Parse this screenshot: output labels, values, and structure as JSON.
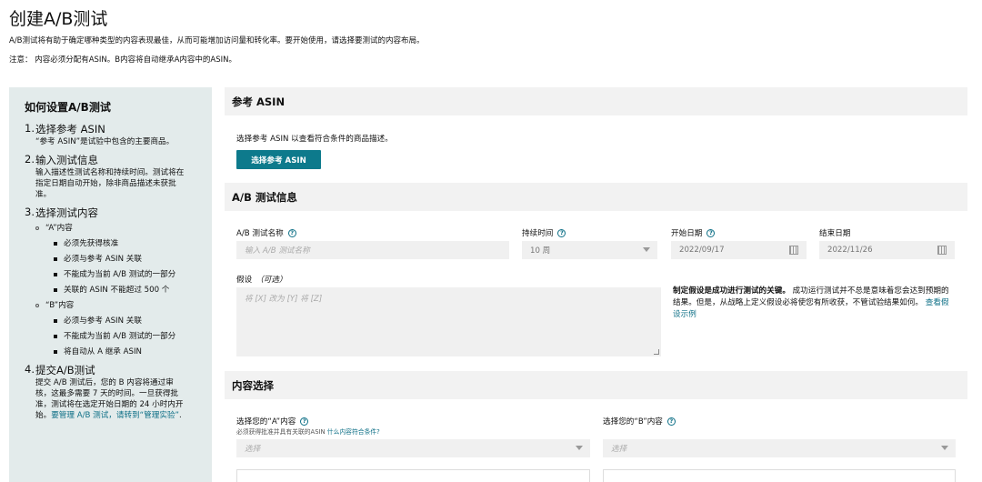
{
  "page": {
    "title": "创建A/B测试",
    "intro": "A/B测试将有助于确定哪种类型的内容表现最佳，从而可能增加访问量和转化率。要开始使用，请选择要测试的内容布局。",
    "note": "注意：  内容必须分配有ASIN。B内容将自动继承A内容中的ASIN。"
  },
  "sidebar": {
    "title": "如何设置A/B测试",
    "step1": {
      "num": "1.",
      "title": "选择参考 ASIN",
      "body": "“参考 ASIN”是试验中包含的主要商品。"
    },
    "step2": {
      "num": "2.",
      "title": "输入测试信息",
      "body": "输入描述性测试名称和持续时间。测试将在指定日期自动开始，除非商品描述未获批准。"
    },
    "step3": {
      "num": "3.",
      "title": "选择测试内容",
      "a_label": "“A”内容",
      "a_items": [
        "必须先获得核准",
        "必须与参考 ASIN 关联",
        "不能成为当前 A/B 测试的一部分",
        "关联的 ASIN 不能超过 500 个"
      ],
      "b_label": "“B”内容",
      "b_items": [
        "必须与参考 ASIN 关联",
        "不能成为当前 A/B 测试的一部分",
        "将自动从 A 继承 ASIN"
      ]
    },
    "step4": {
      "num": "4.",
      "title": "提交A/B测试",
      "body": "提交 A/B 测试后，您的 B 内容将通过审核，这最多需要 7 天的时间。一旦获得批准，测试将在选定开始日期的 24 小时内开始。",
      "link": "要管理 A/B 测试，请转到“管理实验”",
      "tail": "."
    }
  },
  "ref_asin": {
    "header": "参考 ASIN",
    "desc": "选择参考 ASIN 以查看符合条件的商品描述。",
    "button": "选择参考 ASIN"
  },
  "test_info": {
    "header": "A/B 测试信息",
    "name_label": "A/B 测试名称",
    "name_placeholder": "输入 A/B 测试名称",
    "duration_label": "持续时间",
    "duration_value": "10 周",
    "start_label": "开始日期",
    "start_value": "2022/09/17",
    "end_label": "结束日期",
    "end_value": "2022/11/26",
    "hypo_label": "假设",
    "hypo_optional": "（可选）",
    "hypo_placeholder": "将 [X] 改为 [Y] 将 [Z]",
    "hint_bold": "制定假设是成功进行测试的关键。",
    "hint_text": "成功运行测试并不总是意味着您会达到预期的结果。但是，从战略上定义假设必将使您有所收获，不管试验结果如何。",
    "hint_link": "查看假设示例"
  },
  "content_select": {
    "header": "内容选择",
    "a_label": "选择您的“A”内容",
    "a_sub": "必须获得批准并具有关联的ASIN",
    "a_sub_link": "什么内容符合条件?",
    "a_placeholder": "选择",
    "b_label": "选择您的“B”内容",
    "b_placeholder": "选择"
  },
  "colors": {
    "accent": "#0d7a8c",
    "sidebar_bg": "#e3ebeb",
    "section_bg": "#f2f2f2",
    "input_bg": "#f0f0f0"
  }
}
